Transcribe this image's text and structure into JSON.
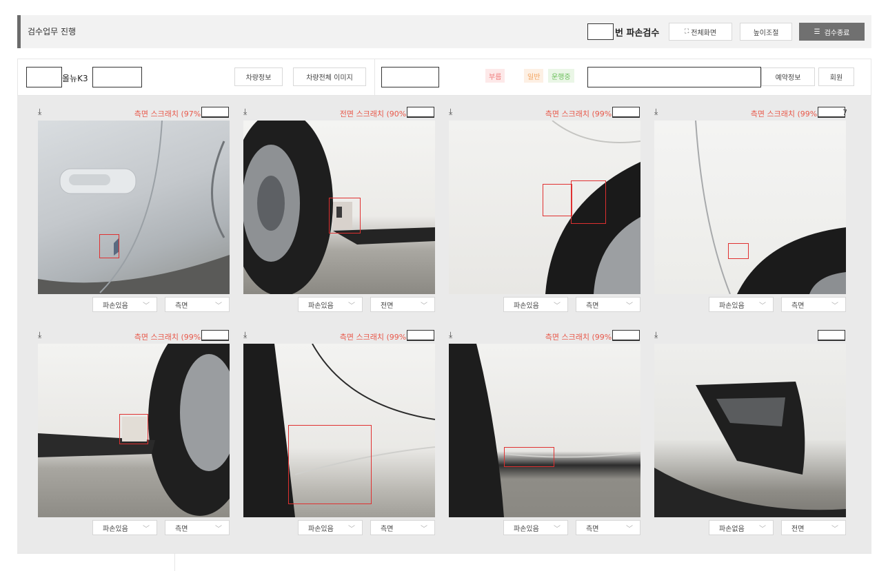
{
  "header": {
    "title": "검수업무 진행",
    "inspect_label": "번 파손검수",
    "fullscreen_label": "전체화면",
    "height_label": "높이조절",
    "finish_label": "검수종료"
  },
  "info": {
    "model": "올뉴K3",
    "vehicle_info_label": "차량정보",
    "vehicle_images_label": "차량전체 이미지",
    "tags": [
      {
        "label": "부름",
        "color": "#f07a7a",
        "bg": "#fde9e9"
      },
      {
        "label": "일반",
        "color": "#f2a35f",
        "bg": "#fdf0e4"
      },
      {
        "label": "운행중",
        "color": "#6cbf5c",
        "bg": "#eaf6e6"
      }
    ],
    "reservation_label": "예약정보",
    "member_label": "회원"
  },
  "cards": [
    {
      "label": "측면 스크래치 (97%),",
      "damage": "파손있음",
      "side": "측면"
    },
    {
      "label": "전면 스크래치 (90%),",
      "damage": "파손있음",
      "side": "전면"
    },
    {
      "label": "측면 스크래치 (99%),",
      "damage": "파손있음",
      "side": "측면"
    },
    {
      "label": "측면 스크래치 (99%),",
      "suffix": "7",
      "damage": "파손있음",
      "side": "측면"
    },
    {
      "label": "측면 스크래치 (99%),",
      "damage": "파손있음",
      "side": "측면"
    },
    {
      "label": "측면 스크래치 (99%),",
      "damage": "파손있음",
      "side": "측면"
    },
    {
      "label": "측면 스크래치 (99%),",
      "damage": "파손있음",
      "side": "측면"
    },
    {
      "label": "",
      "damage": "파손없음",
      "side": "전면"
    }
  ],
  "icons": {
    "download": "download-icon",
    "fullscreen": "fullscreen-icon",
    "menu": "menu-icon",
    "chevron": "chevron-down-icon"
  }
}
